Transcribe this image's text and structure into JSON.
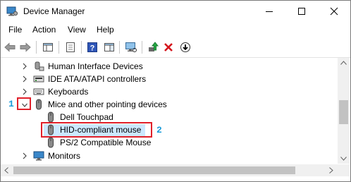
{
  "window": {
    "title": "Device Manager"
  },
  "menu": [
    "File",
    "Action",
    "View",
    "Help"
  ],
  "tree": {
    "items": [
      {
        "label": "Human Interface Devices",
        "icon": "hid-icon"
      },
      {
        "label": "IDE ATA/ATAPI controllers",
        "icon": "ide-controller-icon"
      },
      {
        "label": "Keyboards",
        "icon": "keyboard-icon"
      },
      {
        "label": "Mice and other pointing devices",
        "icon": "mouse-icon",
        "expanded": true
      },
      {
        "label": "Dell Touchpad",
        "icon": "mouse-icon"
      },
      {
        "label": "HID-compliant mouse",
        "icon": "mouse-icon",
        "selected": true
      },
      {
        "label": "PS/2 Compatible Mouse",
        "icon": "mouse-icon"
      },
      {
        "label": "Monitors",
        "icon": "monitor-icon"
      }
    ]
  },
  "annotations": {
    "step1": "1",
    "step2": "2"
  },
  "colors": {
    "selection": "#cce8ff",
    "highlight": "#e0202a",
    "annotation": "#1a9bd8"
  }
}
